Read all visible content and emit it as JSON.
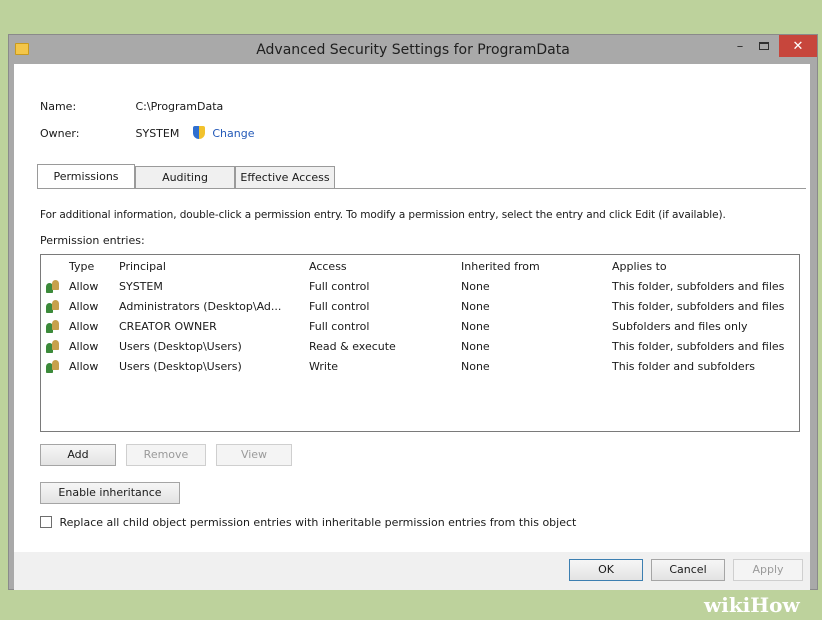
{
  "window": {
    "title": "Advanced Security Settings for ProgramData",
    "minimize_glyph": "–",
    "close_glyph": "✕",
    "icon": "folder-icon"
  },
  "info": {
    "name_label": "Name:",
    "name_value": "C:\\ProgramData",
    "owner_label": "Owner:",
    "owner_value": "SYSTEM",
    "change_link": "Change"
  },
  "tabs": [
    {
      "label": "Permissions",
      "active": true
    },
    {
      "label": "Auditing",
      "active": false
    },
    {
      "label": "Effective Access",
      "active": false
    }
  ],
  "description": "For additional information, double-click a permission entry. To modify a permission entry, select the entry and click Edit (if available).",
  "entries_label": "Permission entries:",
  "columns": {
    "type": "Type",
    "principal": "Principal",
    "access": "Access",
    "inherited": "Inherited from",
    "applies": "Applies to"
  },
  "rows": [
    {
      "type": "Allow",
      "principal": "SYSTEM",
      "access": "Full control",
      "inherited": "None",
      "applies": "This folder, subfolders and files"
    },
    {
      "type": "Allow",
      "principal": "Administrators (Desktop\\Ad...",
      "access": "Full control",
      "inherited": "None",
      "applies": "This folder, subfolders and files"
    },
    {
      "type": "Allow",
      "principal": "CREATOR OWNER",
      "access": "Full control",
      "inherited": "None",
      "applies": "Subfolders and files only"
    },
    {
      "type": "Allow",
      "principal": "Users (Desktop\\Users)",
      "access": "Read & execute",
      "inherited": "None",
      "applies": "This folder, subfolders and files"
    },
    {
      "type": "Allow",
      "principal": "Users (Desktop\\Users)",
      "access": "Write",
      "inherited": "None",
      "applies": "This folder and subfolders"
    }
  ],
  "buttons": {
    "add": "Add",
    "remove": "Remove",
    "view": "View",
    "enable_inheritance": "Enable inheritance",
    "ok": "OK",
    "cancel": "Cancel",
    "apply": "Apply"
  },
  "replace_checkbox": {
    "label": "Replace all child object permission entries with inheritable permission entries from this object",
    "checked": false
  },
  "watermark": {
    "part1": "wiki",
    "part2": "How"
  },
  "colors": {
    "background": "#bdd29c",
    "close_button": "#c7463c",
    "link": "#2359b8"
  }
}
